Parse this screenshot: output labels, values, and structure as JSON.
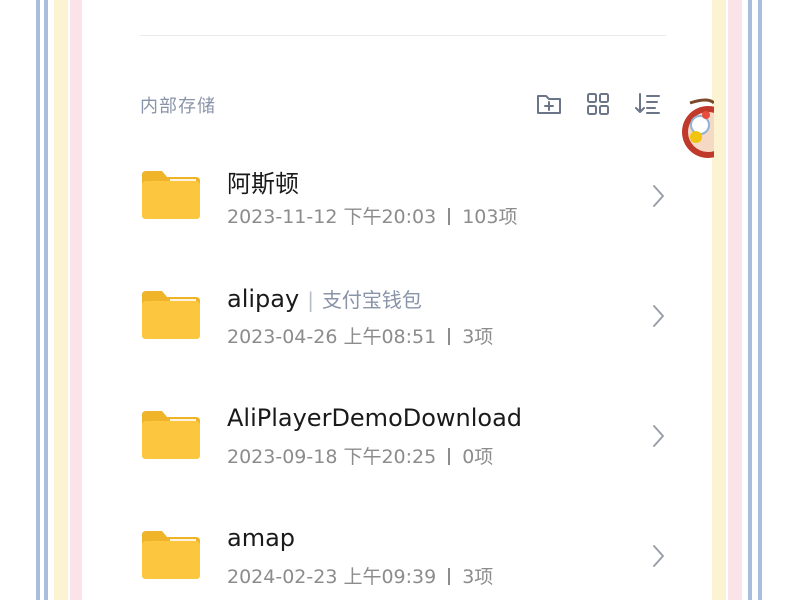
{
  "section": {
    "title": "内部存储",
    "toolbar": [
      "new-folder-icon",
      "grid-view-icon",
      "sort-icon"
    ]
  },
  "folders": [
    {
      "name": "阿斯顿",
      "alias": "",
      "date": "2023-11-12 下午20:03",
      "count": "103项"
    },
    {
      "name": "alipay",
      "alias": "支付宝钱包",
      "alias_sep": "|",
      "date": "2023-04-26 上午08:51",
      "count": "3项"
    },
    {
      "name": "AliPlayerDemoDownload",
      "alias": "",
      "date": "2023-09-18 下午20:25",
      "count": "0项"
    },
    {
      "name": "amap",
      "alias": "",
      "date": "2024-02-23 上午09:39",
      "count": "3项"
    }
  ],
  "colors": {
    "folder": "#fcc63f",
    "folder_dark": "#f0b429",
    "accent_text": "#8a94a8"
  }
}
